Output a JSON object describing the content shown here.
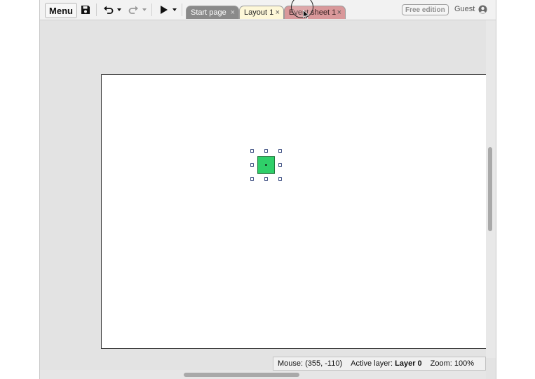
{
  "toolbar": {
    "menu_label": "Menu",
    "icons": {
      "save": "save-icon",
      "undo": "undo-icon",
      "redo": "redo-icon",
      "play": "play-icon",
      "dropdown": "caret-down-icon"
    }
  },
  "tabs": [
    {
      "label": "Start page",
      "close": "×",
      "state": "inactive",
      "color": "#8a8a8a"
    },
    {
      "label": "Layout 1",
      "close": "×",
      "state": "active",
      "color": "#fdf7d8"
    },
    {
      "label": "Event sheet 1",
      "close": "×",
      "state": "inactive",
      "color": "#d9989a"
    }
  ],
  "header_right": {
    "edition": "Free edition",
    "user": "Guest",
    "user_icon": "user-circle-icon"
  },
  "layout": {
    "background_color": "#ffffff",
    "sprite": {
      "color": "#2fcf69",
      "selected": true
    }
  },
  "status": {
    "mouse_prefix": "Mouse:",
    "mouse_value": "(355, -110)",
    "layer_prefix": "Active layer:",
    "layer_value": "Layer 0",
    "zoom_prefix": "Zoom:",
    "zoom_value": "100%"
  }
}
